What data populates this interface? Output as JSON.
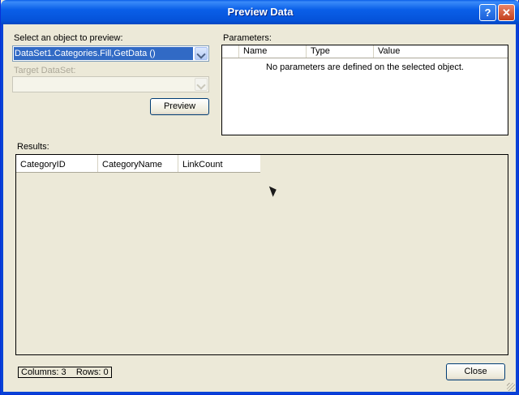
{
  "window": {
    "title": "Preview Data",
    "help_glyph": "?",
    "close_glyph": "✕"
  },
  "select_object": {
    "label": "Select an object to preview:",
    "value": "DataSet1.Categories.Fill,GetData ()"
  },
  "target_dataset": {
    "label": "Target DataSet:",
    "value": ""
  },
  "preview_button": "Preview",
  "parameters": {
    "label": "Parameters:",
    "columns": [
      "Name",
      "Type",
      "Value"
    ],
    "empty_message": "No parameters are defined on the selected object."
  },
  "results": {
    "label": "Results:",
    "columns": [
      "CategoryID",
      "CategoryName",
      "LinkCount"
    ]
  },
  "status": {
    "text": "Columns: 3    Rows: 0"
  },
  "close_button": "Close",
  "colors": {
    "title_bar": "#0a5fe8",
    "selection": "#316ac5",
    "dialog_bg": "#ece9d8"
  }
}
